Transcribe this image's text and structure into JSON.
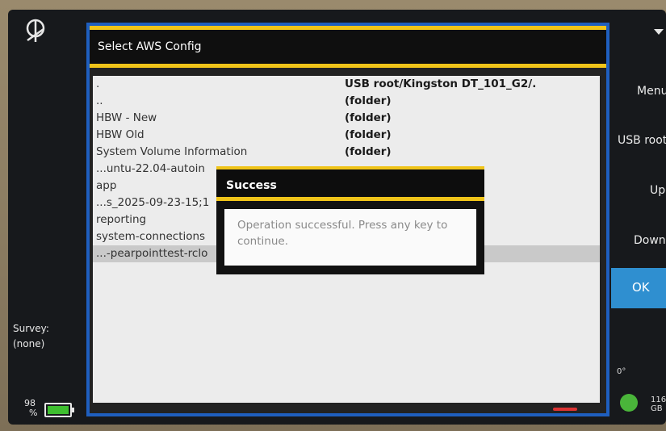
{
  "dialog": {
    "title": "Select AWS Config"
  },
  "file_list": {
    "rows": [
      {
        "name": ".",
        "type": "USB root/Kingston DT_101_G2/."
      },
      {
        "name": "..",
        "type": "(folder)"
      },
      {
        "name": "HBW - New",
        "type": "(folder)"
      },
      {
        "name": "HBW Old",
        "type": "(folder)"
      },
      {
        "name": "System Volume Information",
        "type": "(folder)"
      },
      {
        "name": "...untu-22.04-autoin",
        "type": ""
      },
      {
        "name": "app",
        "type": ""
      },
      {
        "name": "...s_2025-09-23-15;1",
        "type": ""
      },
      {
        "name": "reporting",
        "type": ""
      },
      {
        "name": "system-connections",
        "type": ""
      },
      {
        "name": "...-pearpointtest-rclo",
        "type": ""
      }
    ]
  },
  "popup": {
    "title": "Success",
    "message": "Operation successful. Press any key to continue."
  },
  "left_panel": {
    "survey_label": "Survey:",
    "survey_value": "(none)",
    "battery_percent": "98",
    "battery_unit": "%"
  },
  "right_panel": {
    "menu_label": "Menu",
    "usb_root_label": "USB root",
    "up_label": "Up",
    "down_label": "Down",
    "ok_label": "OK",
    "tilt": "0°",
    "storage_value": "116",
    "storage_unit": "GB"
  },
  "colors": {
    "accent_yellow": "#f0c419",
    "frame_blue": "#1f5fbf",
    "ok_blue": "#2f8fd0",
    "battery_green": "#3fbf30"
  }
}
